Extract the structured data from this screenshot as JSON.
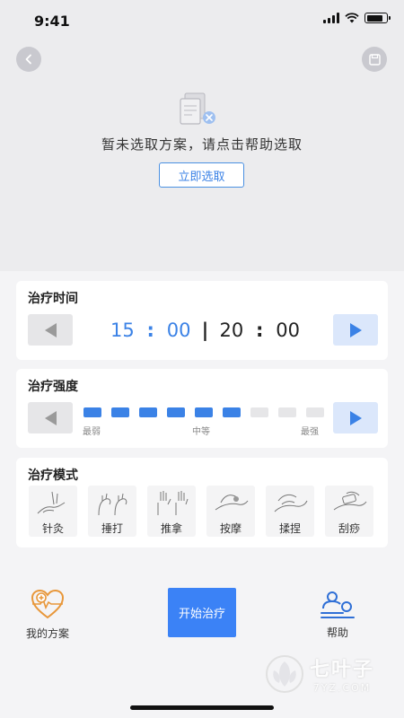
{
  "status_bar": {
    "time": "9:41",
    "battery_level": 0.85
  },
  "header": {
    "back_icon": "chevron-left-icon",
    "save_icon": "save-icon"
  },
  "empty_state": {
    "icon": "no-document-icon",
    "message": "暂未选取方案，请点击帮助选取",
    "select_button": "立即选取"
  },
  "treatment_time": {
    "title": "治疗时间",
    "current_minutes": "15",
    "current_seconds": "00",
    "total_minutes": "20",
    "total_seconds": "00"
  },
  "treatment_strength": {
    "title": "治疗强度",
    "level": 6,
    "max_level": 9,
    "label_min": "最弱",
    "label_mid": "中等",
    "label_max": "最强",
    "active_color": "#3b82e6",
    "inactive_color": "#e6e6e8"
  },
  "treatment_mode": {
    "title": "治疗模式",
    "modes": [
      {
        "label": "针灸",
        "icon": "acupuncture-icon"
      },
      {
        "label": "捶打",
        "icon": "tapping-icon"
      },
      {
        "label": "推拿",
        "icon": "pushing-icon"
      },
      {
        "label": "按摩",
        "icon": "massage-icon"
      },
      {
        "label": "揉捏",
        "icon": "kneading-icon"
      },
      {
        "label": "刮痧",
        "icon": "scraping-icon"
      }
    ]
  },
  "bottom_nav": {
    "my_plan": "我的方案",
    "start": "开始治疗",
    "help": "帮助"
  },
  "watermark": {
    "cn": "七叶子",
    "en": "7YZ.COM"
  },
  "colors": {
    "accent": "#3b82e6",
    "plan_icon": "#e8973a",
    "help_icon": "#2f6fd6"
  }
}
